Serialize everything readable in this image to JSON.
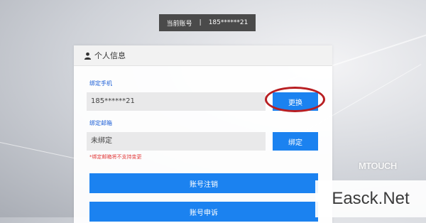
{
  "account_bar": {
    "label": "当前账号",
    "separator": "|",
    "value": "185******21"
  },
  "profile": {
    "title": "个人信息",
    "phone": {
      "label": "绑定手机",
      "value": "185******21",
      "button": "更换"
    },
    "email": {
      "label": "绑定邮箱",
      "value": "未绑定",
      "button": "绑定",
      "note": "*绑定邮箱将不支持变更"
    },
    "actions": {
      "cancel_account": "账号注销",
      "appeal": "账号申诉"
    }
  },
  "watermarks": {
    "logo": "MTOUCH",
    "site": "Easck.Net"
  },
  "colors": {
    "accent": "#1b82f0",
    "highlight": "#b81e22",
    "warning": "#e23a3a"
  }
}
